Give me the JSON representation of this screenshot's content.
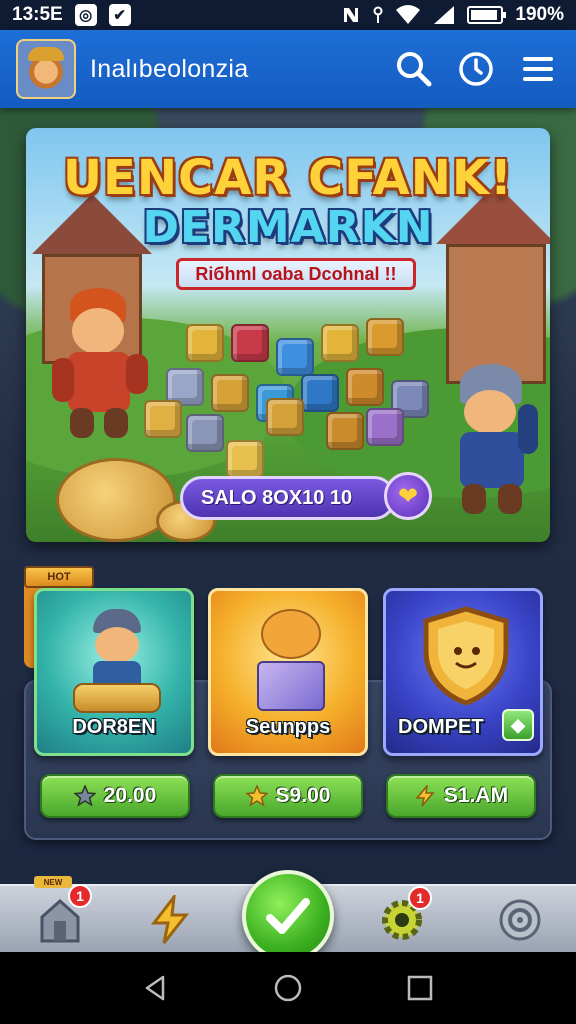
{
  "status_bar": {
    "time": "13:5E",
    "left_icons": [
      "target-icon",
      "check-box-icon"
    ],
    "right_icons": [
      "nfc-icon",
      "signal-dot-icon",
      "wifi-icon",
      "cellular-icon",
      "battery-icon"
    ],
    "battery_text": "190%"
  },
  "app_bar": {
    "title": "Inalıbeolonzia",
    "actions": [
      "search-icon",
      "clock-icon",
      "menu-icon"
    ]
  },
  "banner": {
    "title_line_1": "UENCAR CFANK!",
    "title_line_2": "DERMARKN",
    "ribbon": "Riбhml oaba Dcohnal !!",
    "promo": "SALO 8OX10 10"
  },
  "store": {
    "tag": "HOT",
    "items": [
      {
        "name": "DOR8EN",
        "price": "20.00",
        "price_icon": "star-icon"
      },
      {
        "name": "Seunpps",
        "price": "S9.00",
        "price_icon": "gear-star-icon"
      },
      {
        "name": "DOMPET",
        "price": "S1.AM",
        "price_icon": "lightning-icon",
        "badge": "◆"
      }
    ]
  },
  "bottom_nav": {
    "new_label": "NEW",
    "items": [
      {
        "icon": "house-icon",
        "badge": "1"
      },
      {
        "icon": "lightning-icon",
        "badge": ""
      },
      {
        "icon": "check-icon",
        "badge": ""
      },
      {
        "icon": "gear-icon",
        "badge": "1"
      },
      {
        "icon": "target-icon",
        "badge": ""
      }
    ]
  },
  "system_nav": [
    "back-icon",
    "home-icon",
    "recents-icon"
  ],
  "colors": {
    "app_bar": "#1e6fd6",
    "price_green": "#4aa82c",
    "badge_red": "#e42b2b"
  }
}
